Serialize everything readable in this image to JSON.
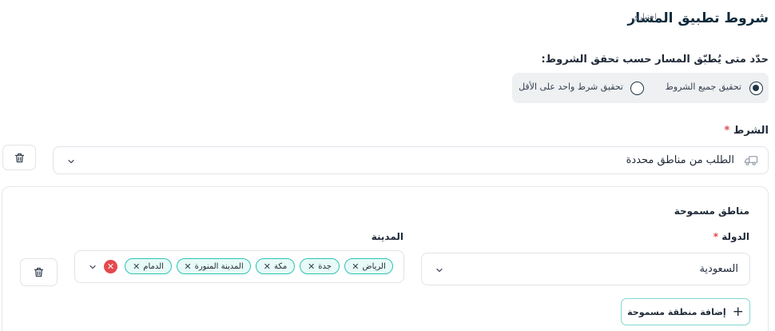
{
  "header": {
    "title": "شروط تطبيق المسار",
    "optional_label": "اختياري"
  },
  "match_mode": {
    "question": "حدّد متى يُطبّق المسار حسب تحقق الشروط:",
    "options": [
      {
        "label": "تحقيق جميع الشروط",
        "selected": true
      },
      {
        "label": "تحقيق شرط واحد على الأقل",
        "selected": false
      }
    ]
  },
  "condition": {
    "label": "الشرط",
    "required_mark": "*",
    "selected_value": "الطلب من مناطق محددة",
    "icon": "truck-icon"
  },
  "allowed_zones": {
    "title": "مناطق مسموحة",
    "country_label": "الدولة",
    "country_required_mark": "*",
    "country_value": "السعودية",
    "city_label": "المدينة",
    "cities": [
      "الرياض",
      "جدة",
      "مكة",
      "المدينة المنورة",
      "الدمام"
    ],
    "add_button_label": "إضافة منطقة مسموحة"
  },
  "colors": {
    "accent": "#2ec4b6",
    "chip_bg": "#e8faf7",
    "danger": "#e5484d",
    "title": "#0d2a3a"
  }
}
